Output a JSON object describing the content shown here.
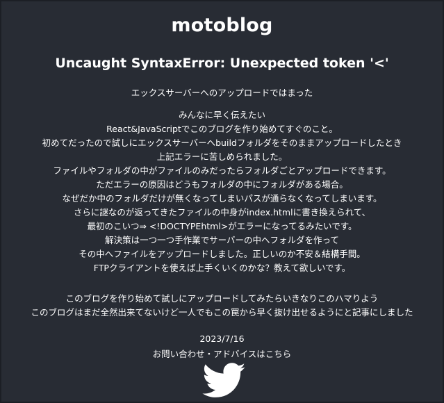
{
  "site": {
    "title": "motoblog"
  },
  "post": {
    "title": "Uncaught SyntaxError: Unexpected token '<'",
    "subtitle": "エックスサーバーへのアップロードではまった",
    "body": [
      "みんなに早く伝えたい",
      "React&JavaScriptでこのブログを作り始めてすぐのこと。",
      "初めてだったので試しにエックスサーバーへbuildフォルダをそのままアップロードしたとき",
      "上記エラーに苦しめられました。",
      "ファイルやフォルダの中がファイルのみだったらフォルダごとアップロードできます。",
      "ただエラーの原因はどうもフォルダの中にフォルダがある場合。",
      "なぜだか中のフォルダだけが無くなってしまいパスが通らなくなってしまいます。",
      "さらに謎なのが返ってきたファイルの中身がindex.htmlに書き換えられて、",
      "最初のこいつ⇒ <!DOCTYPEhtml>がエラーになってるみたいです。",
      "解決策は一つ一つ手作業でサーバーの中へフォルダを作って",
      "その中へファイルをアップロードしました。正しいのか不安＆結構手間。",
      "FTPクライアントを使えば上手くいくのかな？教えて欲しいです。"
    ],
    "closing": [
      "このブログを作り始めて試しにアップロードしてみたらいきなりこのハマりよう",
      "このブログはまだ全然出来てないけど一人でもこの罠から早く抜け出せるようにと記事にしました"
    ],
    "date": "2023/7/16"
  },
  "footer": {
    "contact_label": "お問い合わせ・アドバイスはこちら",
    "twitter_icon": "twitter-bird-icon"
  },
  "colors": {
    "background": "#282c34",
    "text": "#ffffff"
  }
}
